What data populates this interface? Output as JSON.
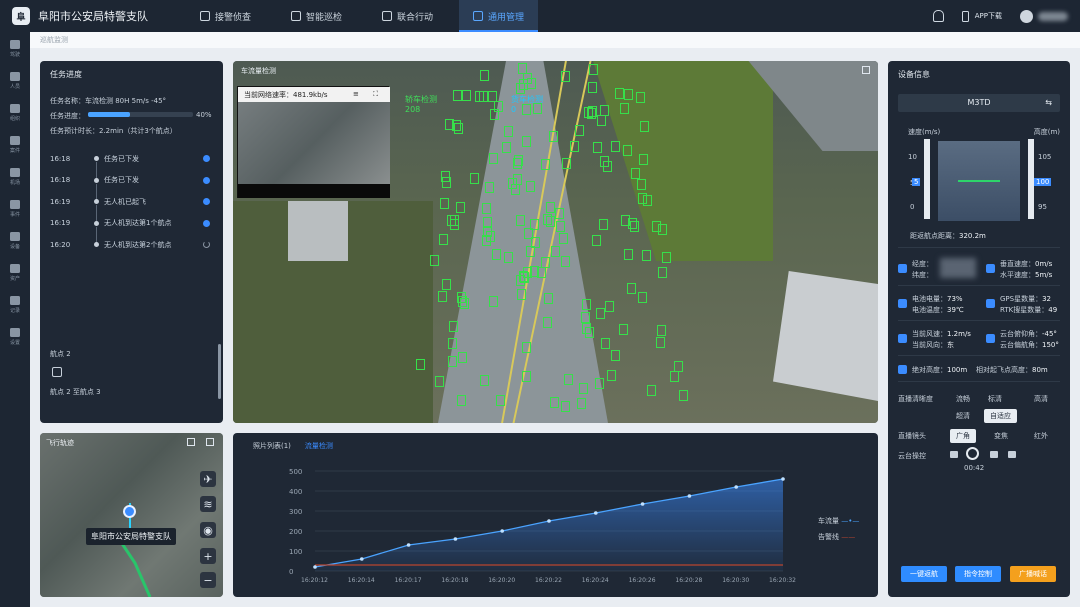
{
  "header": {
    "logo_glyph": "阜",
    "title": "阜阳市公安局特警支队",
    "nav": [
      {
        "label": "接警侦查",
        "active": false
      },
      {
        "label": "智能巡检",
        "active": false
      },
      {
        "label": "联合行动",
        "active": false
      },
      {
        "label": "通用管理",
        "active": true
      }
    ],
    "app_download": "APP下载"
  },
  "sidebar": {
    "items": [
      "驾驶",
      "人员",
      "组织",
      "案件",
      "机场",
      "事件",
      "设备",
      "资产",
      "记录",
      "设置"
    ]
  },
  "breadcrumb": "巡航监测",
  "task": {
    "title": "任务进度",
    "name_label": "任务名称：",
    "name_value": "车流检测 80H 5m/s -45°",
    "progress_label": "任务进度：",
    "progress_value": "40%",
    "progress_fraction": 0.4,
    "eta_label": "任务预计时长：",
    "eta_value": "2.2min（共计3个航点）",
    "timeline": [
      {
        "time": "16:18",
        "text": "任务已下发",
        "done": true
      },
      {
        "time": "16:18",
        "text": "任务已下发",
        "done": true
      },
      {
        "time": "16:19",
        "text": "无人机已起飞",
        "done": true
      },
      {
        "time": "16:19",
        "text": "无人机到达第1个航点",
        "done": true
      },
      {
        "time": "16:20",
        "text": "无人机到达第2个航点",
        "done": false
      }
    ],
    "waypoint": "航点 2",
    "waypoint_range": "航点 2 至航点 3"
  },
  "video": {
    "title": "车流量检测",
    "pip_rate_label": "当前网络速率：",
    "pip_rate": "481.9kb/s",
    "legend_car": "轿车检测",
    "legend_count": "208",
    "legend_truck": "货车检测",
    "legend_truck_count": "0"
  },
  "map": {
    "title": "飞行轨迹",
    "label": "阜阳市公安局特警支队",
    "zoom_in": "+",
    "zoom_out": "−"
  },
  "chart_tabs": [
    {
      "label": "照片列表(1)",
      "active": false
    },
    {
      "label": "流量检测",
      "active": true
    }
  ],
  "chart_data": {
    "type": "line",
    "categories": [
      "16:20:12",
      "16:20:14",
      "16:20:17",
      "16:20:18",
      "16:20:20",
      "16:20:22",
      "16:20:24",
      "16:20:26",
      "16:20:28",
      "16:20:30",
      "16:20:32"
    ],
    "series": [
      {
        "name": "车流量",
        "color": "#4aa3ff",
        "values": [
          20,
          60,
          130,
          160,
          200,
          250,
          290,
          335,
          375,
          420,
          460
        ]
      },
      {
        "name": "告警线",
        "color": "#b8452f",
        "values": [
          30,
          30,
          30,
          30,
          30,
          30,
          30,
          30,
          30,
          30,
          30
        ]
      }
    ],
    "x_ticks": [
      "16:20:12",
      "16:20:14",
      "16:20:17",
      "16:20:18",
      "16:20:20",
      "16:20:22",
      "16:20:24",
      "16:20:26",
      "16:20:28",
      "16:20:30",
      "16:20:32"
    ],
    "y_ticks": [
      "0",
      "100",
      "200",
      "300",
      "400",
      "500"
    ],
    "ylim": [
      0,
      500
    ],
    "grid": true,
    "legend": "right"
  },
  "device": {
    "title": "设备信息",
    "drone": "M3TD",
    "gauge_left_label": "速度(m/s)",
    "gauge_right_label": "高度(m)",
    "gauge_left_ticks": [
      "10",
      "5",
      "0"
    ],
    "gauge_right_ticks": [
      "105",
      "100",
      "95"
    ],
    "gauge_left_value": "5",
    "gauge_right_value": "100",
    "distance_label": "距返航点距离：",
    "distance_value": "320.2m",
    "lng_label": "经度：",
    "lat_label": "纬度：",
    "vspeed_label": "垂直速度：",
    "vspeed_value": "0m/s",
    "hspeed_label": "水平速度：",
    "hspeed_value": "5m/s",
    "battery_label": "电池电量：",
    "battery_value": "73%",
    "battemp_label": "电池温度：",
    "battemp_value": "39℃",
    "gps_label": "GPS星数量：",
    "gps_value": "32",
    "rtk_label": "RTK搜星数量：",
    "rtk_value": "49",
    "wind_label": "当前风速：",
    "wind_value": "1.2m/s",
    "winddir_label": "当前风向：",
    "winddir_value": "东",
    "gimbal_pitch_label": "云台俯仰角：",
    "gimbal_pitch_value": "-45°",
    "gimbal_yaw_label": "云台偏航角：",
    "gimbal_yaw_value": "150°",
    "alt_label": "绝对高度：",
    "alt_value": "100m",
    "rel_alt_label": "相对起飞点高度：",
    "rel_alt_value": "80m",
    "stream_label": "直播清晰度",
    "stream_opts": [
      {
        "t": "流畅",
        "sel": false
      },
      {
        "t": "标清",
        "sel": false
      },
      {
        "t": "高清",
        "sel": false
      },
      {
        "t": "超清",
        "sel": false
      },
      {
        "t": "自适应",
        "sel": true
      }
    ],
    "lens_label": "直播镜头",
    "lens_opts": [
      {
        "t": "广角",
        "sel": true
      },
      {
        "t": "变焦",
        "sel": false
      },
      {
        "t": "红外",
        "sel": false
      }
    ],
    "gimbal_ctrl_label": "云台操控",
    "timer": "00:42",
    "buttons": [
      {
        "t": "一键返航",
        "c": "blue"
      },
      {
        "t": "指令控制",
        "c": "blue"
      },
      {
        "t": "广播喊话",
        "c": "orange"
      }
    ]
  }
}
